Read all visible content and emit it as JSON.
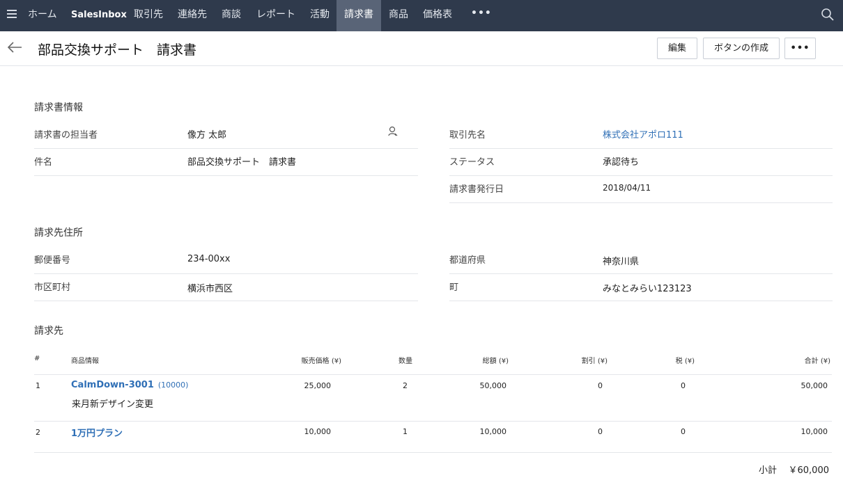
{
  "nav": {
    "items": [
      "ホーム",
      "SalesInbox",
      "取引先",
      "連絡先",
      "商談",
      "レポート",
      "活動",
      "請求書",
      "商品",
      "価格表"
    ],
    "active": "請求書",
    "more": "•••"
  },
  "header": {
    "title": "部品交換サポート　請求書",
    "edit_label": "編集",
    "create_button_label": "ボタンの作成",
    "more_label": "•••"
  },
  "invoice_info": {
    "section_title": "請求書情報",
    "owner_label": "請求書の担当者",
    "owner_value": "像方 太郎",
    "subject_label": "件名",
    "subject_value": "部品交換サポート　請求書",
    "account_label": "取引先名",
    "account_value": "株式会社アポロ111",
    "status_label": "ステータス",
    "status_value": "承認待ち",
    "date_label": "請求書発行日",
    "date_value": "2018/04/11"
  },
  "billing_address": {
    "section_title": "請求先住所",
    "zip_label": "郵便番号",
    "zip_value": "234-00xx",
    "city_label": "市区町村",
    "city_value": "横浜市西区",
    "prefecture_label": "都道府県",
    "prefecture_value": "神奈川県",
    "town_label": "町",
    "town_value": "みなとみらい123123"
  },
  "items": {
    "section_title": "請求先",
    "headers": {
      "num": "#",
      "product": "商品情報",
      "price": "販売価格 (¥)",
      "qty": "数量",
      "amount": "総額 (¥)",
      "discount": "割引 (¥)",
      "tax": "税 (¥)",
      "total": "合計 (¥)"
    },
    "rows": [
      {
        "num": "1",
        "name": "CalmDown-3001",
        "code": "(10000)",
        "desc": "来月新デザイン変更",
        "price": "25,000",
        "qty": "2",
        "amount": "50,000",
        "discount": "0",
        "tax": "0",
        "total": "50,000"
      },
      {
        "num": "2",
        "name": "1万円プラン",
        "code": "",
        "desc": "",
        "price": "10,000",
        "qty": "1",
        "amount": "10,000",
        "discount": "0",
        "tax": "0",
        "total": "10,000"
      }
    ],
    "subtotal_label": "小計",
    "subtotal_value": "￥60,000"
  },
  "colors": {
    "nav_bg": "#2f3a4c",
    "nav_active": "#596477",
    "link": "#2f6fb6"
  }
}
